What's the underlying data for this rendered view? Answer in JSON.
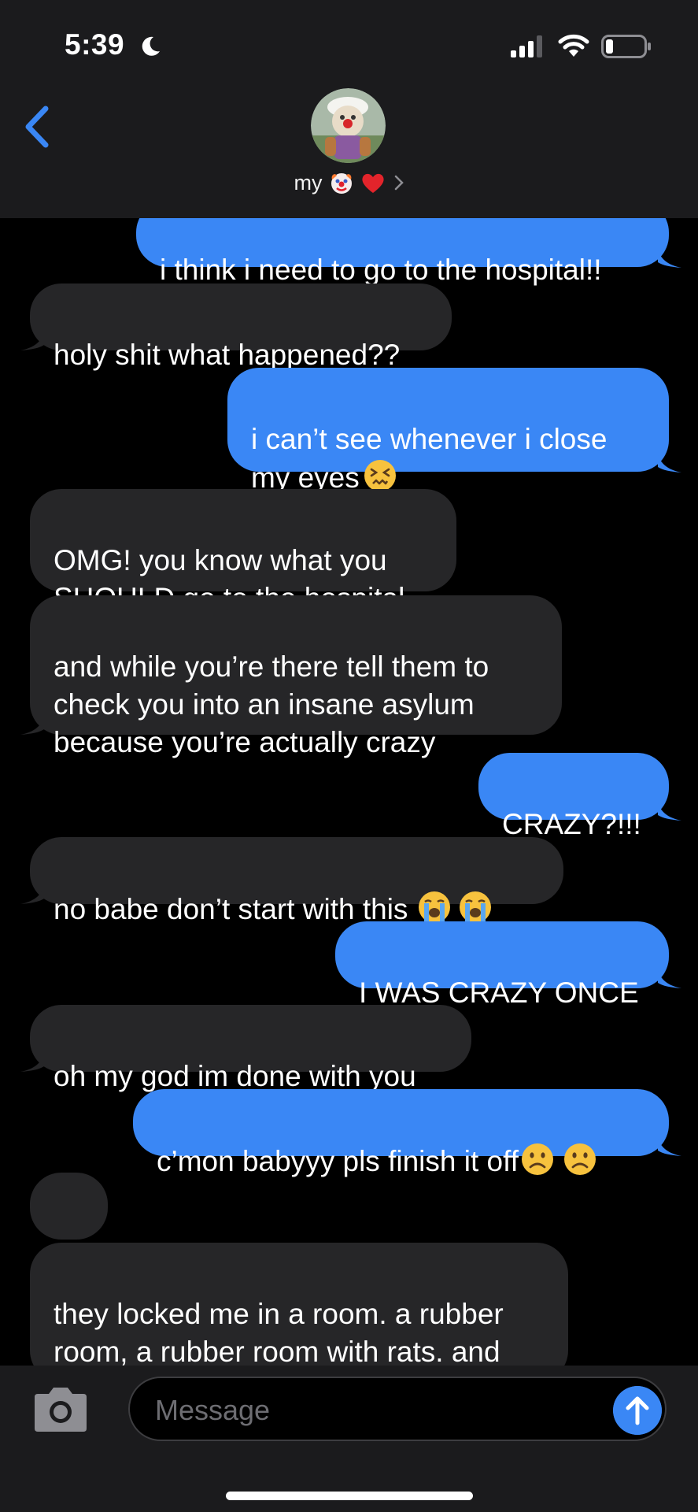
{
  "status_bar": {
    "time": "5:39",
    "icons": [
      "moon-icon",
      "signal-icon",
      "wifi-icon",
      "battery-icon"
    ]
  },
  "header": {
    "contact_name_prefix": "my",
    "contact_name_emojis": [
      "clown-face-emoji",
      "red-heart-emoji"
    ],
    "back_icon": "chevron-left-icon"
  },
  "messages": [
    {
      "side": "sent",
      "text": "i think i need to go to the hospital!!"
    },
    {
      "side": "recv",
      "text": "holy shit what happened??"
    },
    {
      "side": "sent",
      "text": "i can’t see whenever i close\nmy eyes",
      "emojis": [
        "confounded-face-emoji"
      ]
    },
    {
      "side": "recv",
      "text": "OMG! you know what you\nSHOULD go to the hospital"
    },
    {
      "side": "recv",
      "text": "and while you’re there tell them to\ncheck you into an insane asylum\nbecause you’re actually crazy"
    },
    {
      "side": "sent",
      "text": "CRAZY?!!!"
    },
    {
      "side": "recv",
      "text": "no babe don’t start with this",
      "emojis": [
        "loudly-crying-face-emoji",
        "loudly-crying-face-emoji"
      ]
    },
    {
      "side": "sent",
      "text": "I WAS CRAZY ONCE"
    },
    {
      "side": "recv",
      "text": "oh my god im done with you"
    },
    {
      "side": "sent",
      "text": "c’mon babyyy pls finish it off",
      "emojis": [
        "frowning-face-emoji",
        "frowning-face-emoji"
      ]
    },
    {
      "side": "recv",
      "text": "...."
    },
    {
      "side": "recv",
      "text": "they locked me in a room. a rubber\nroom, a rubber room with rats. and\nrats make me crazy!"
    }
  ],
  "input_bar": {
    "placeholder": "Message",
    "value": ""
  },
  "colors": {
    "sent_bubble": "#3a87f5",
    "received_bubble": "#262628",
    "bar_background": "#1b1b1d",
    "accent": "#3a87f5"
  }
}
